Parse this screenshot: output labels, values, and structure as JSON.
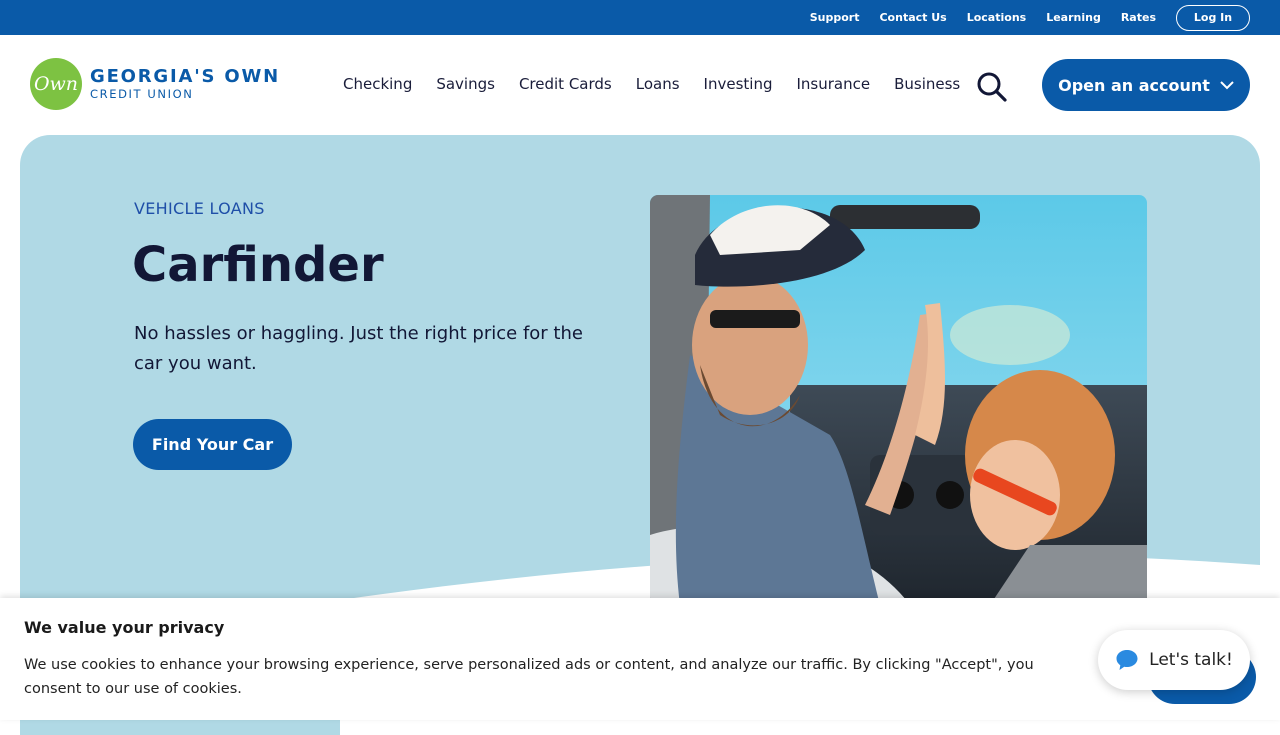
{
  "utility": {
    "links": [
      "Support",
      "Contact Us",
      "Locations",
      "Learning",
      "Rates"
    ],
    "login": "Log In"
  },
  "brand": {
    "badge": "Own",
    "line1": "GEORGIA'S OWN",
    "line2": "CREDIT UNION",
    "primary_color": "#0a5aa8",
    "green": "#7dc242"
  },
  "nav": {
    "items": [
      "Checking",
      "Savings",
      "Credit Cards",
      "Loans",
      "Investing",
      "Insurance",
      "Business"
    ],
    "open_account": "Open an account"
  },
  "hero": {
    "eyebrow": "VEHICLE LOANS",
    "title": "Carfinder",
    "subtitle": "No hassles or haggling. Just the right price for the car you want.",
    "cta": "Find Your Car",
    "background": "#b0d9e5"
  },
  "cookie": {
    "title": "We value your privacy",
    "text": "We use cookies to enhance your browsing experience, serve personalized ads or content, and analyze our traffic. By clicking \"Accept\", you consent to our use of cookies."
  },
  "chat": {
    "label": "Let's talk!"
  }
}
